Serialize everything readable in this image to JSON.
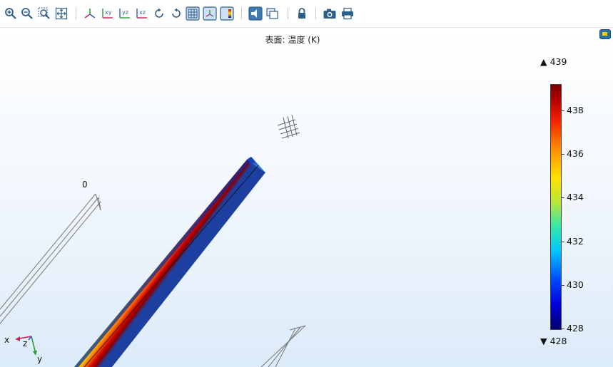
{
  "toolbar": {
    "buttons": [
      {
        "name": "zoom-in-icon",
        "label": "zoom in"
      },
      {
        "name": "zoom-out-icon",
        "label": "zoom out"
      },
      {
        "name": "zoom-box-icon",
        "label": "zoom box"
      },
      {
        "name": "zoom-extents-icon",
        "label": "zoom extents"
      },
      {
        "name": "axes-view-icon",
        "label": "default view"
      },
      {
        "name": "xy-plane-icon",
        "label": "xy"
      },
      {
        "name": "yz-plane-icon",
        "label": "yz"
      },
      {
        "name": "xz-plane-icon",
        "label": "xz"
      },
      {
        "name": "rotate-cw-icon",
        "label": "rotate"
      },
      {
        "name": "rotate-ccw-icon",
        "label": "rotate back"
      },
      {
        "name": "grid-icon",
        "label": "grid"
      },
      {
        "name": "axis-orientation-icon",
        "label": "axis"
      },
      {
        "name": "color-legend-icon",
        "label": "legend"
      },
      {
        "name": "scene-light-icon",
        "label": "scene light"
      },
      {
        "name": "transparency-icon",
        "label": "transparency"
      },
      {
        "name": "lock-icon",
        "label": "lock"
      },
      {
        "name": "camera-icon",
        "label": "image snapshot"
      },
      {
        "name": "print-icon",
        "label": "print"
      }
    ]
  },
  "plot": {
    "title": "表面: 温度 (K)",
    "axis_label_zero": "0",
    "triad": {
      "x": "x",
      "y": "y",
      "z": "z"
    }
  },
  "colorbar": {
    "max_label": "▲ 439",
    "min_label": "▼ 428",
    "range": [
      428,
      439
    ],
    "ticks": [
      "438",
      "436",
      "434",
      "432",
      "430",
      "428"
    ],
    "colormap": "rainbow"
  },
  "colors": {
    "accent": "#2f6fa7",
    "hot": "#8b0000",
    "cold": "#00006a"
  }
}
